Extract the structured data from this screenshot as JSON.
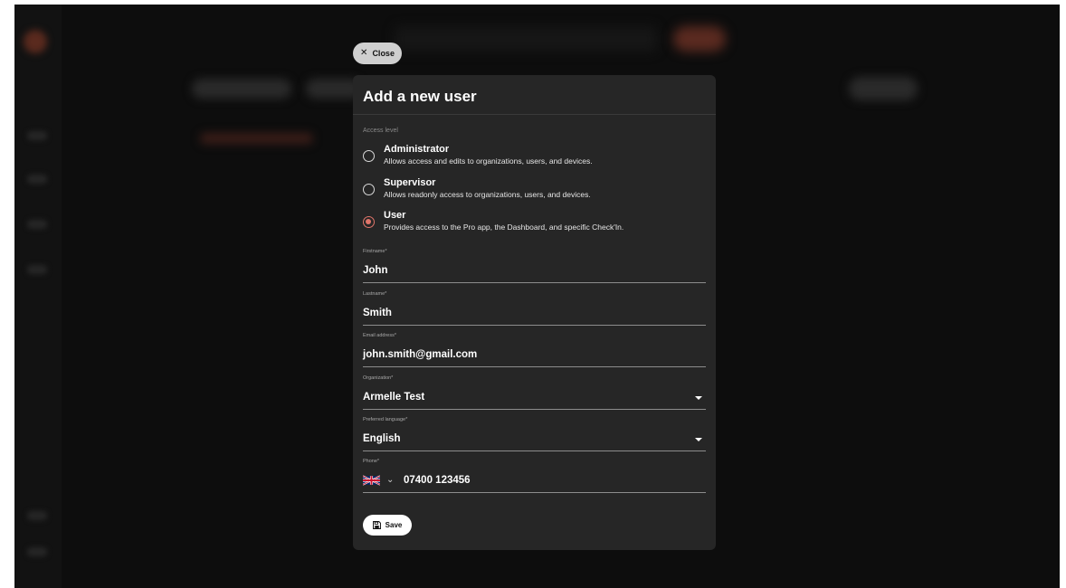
{
  "close_button": {
    "label": "Close",
    "icon": "close-icon"
  },
  "modal": {
    "title": "Add a new user",
    "access_level": {
      "label": "Access level",
      "options": [
        {
          "title": "Administrator",
          "description": "Allows access and edits to organizations, users, and devices.",
          "selected": false
        },
        {
          "title": "Supervisor",
          "description": "Allows readonly access to organizations, users, and devices.",
          "selected": false
        },
        {
          "title": "User",
          "description": "Provides access to the Pro app, the Dashboard, and specific Check'In.",
          "selected": true
        }
      ]
    },
    "fields": {
      "firstname": {
        "label": "Firstname*",
        "value": "John"
      },
      "lastname": {
        "label": "Lastname*",
        "value": "Smith"
      },
      "email": {
        "label": "Email address*",
        "value": "john.smith@gmail.com"
      },
      "organization": {
        "label": "Organization*",
        "value": "Armelle Test"
      },
      "language": {
        "label": "Preferred language*",
        "value": "English"
      },
      "phone": {
        "label": "Phone*",
        "country_flag": "uk-flag-icon",
        "value": "07400 123456"
      }
    },
    "save_button": {
      "label": "Save",
      "icon": "save-icon"
    }
  },
  "colors": {
    "accent": "#e0756a",
    "modal_background": "#262626",
    "page_overlay": "#0d0d0d"
  }
}
